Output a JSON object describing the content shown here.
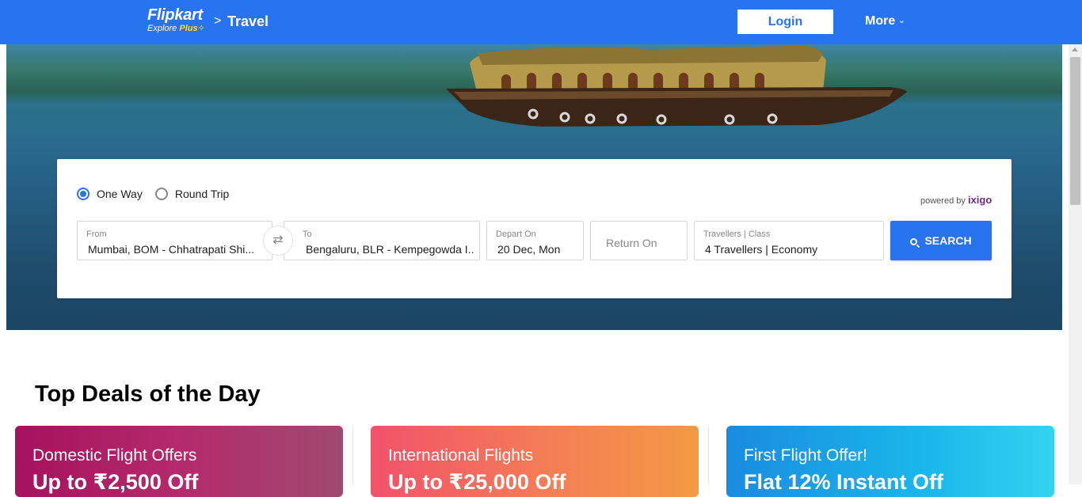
{
  "header": {
    "logo_main": "Flipkart",
    "logo_sub_prefix": "Explore",
    "logo_sub_plus": "Plus",
    "breadcrumb_separator": ">",
    "section_title": "Travel",
    "login_label": "Login",
    "more_label": "More"
  },
  "search": {
    "trip_types": [
      {
        "label": "One Way",
        "selected": true
      },
      {
        "label": "Round Trip",
        "selected": false
      }
    ],
    "powered_by": "powered by",
    "partner": "ixigo",
    "from": {
      "label": "From",
      "value": "Mumbai, BOM - Chhatrapati Shi..."
    },
    "to": {
      "label": "To",
      "value": "Bengaluru, BLR - Kempegowda I..."
    },
    "depart": {
      "label": "Depart On",
      "value": "20 Dec, Mon"
    },
    "return": {
      "placeholder": "Return On"
    },
    "travellers": {
      "label": "Travellers | Class",
      "value": "4 Travellers | Economy"
    },
    "search_label": "SEARCH"
  },
  "deals": {
    "title": "Top Deals of the Day",
    "items": [
      {
        "title": "Domestic Flight Offers",
        "offer": "Up to ₹2,500 Off"
      },
      {
        "title": "International Flights",
        "offer": "Up to ₹25,000 Off"
      },
      {
        "title": "First Flight Offer!",
        "offer": "Flat 12% Instant Off"
      }
    ]
  },
  "colors": {
    "brand_blue": "#2874f0",
    "plus_yellow": "#ffe11b",
    "text_primary": "#212121",
    "text_muted": "#878787"
  },
  "icons": [
    "chevron-right-icon",
    "chevron-down-icon",
    "swap-icon",
    "search-icon",
    "radio-icon"
  ]
}
